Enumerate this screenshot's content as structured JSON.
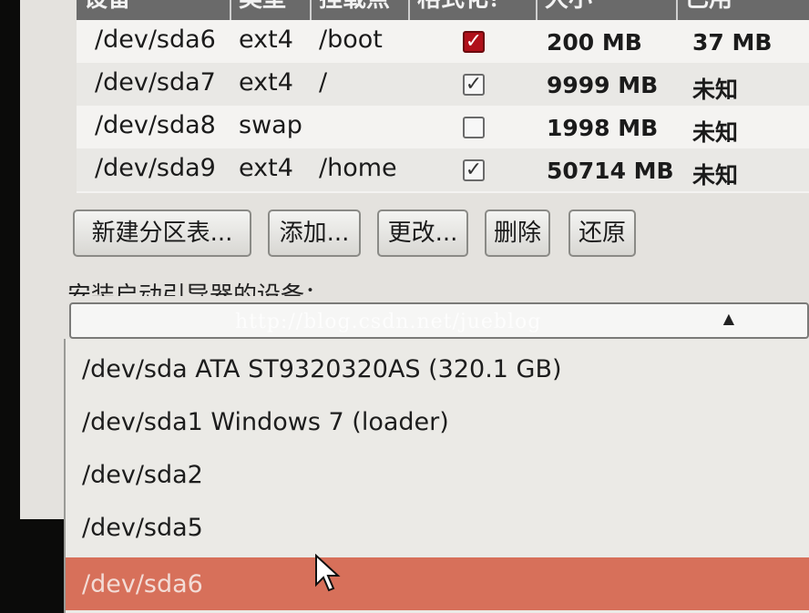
{
  "table": {
    "headers": [
      "设备",
      "类型",
      "挂载点",
      "格式化？",
      "大小",
      "已用"
    ],
    "rows": [
      {
        "device": "/dev/sda6",
        "type": "ext4",
        "mount": "/boot",
        "format": true,
        "format_style": "red",
        "size": "200 MB",
        "used": "37 MB"
      },
      {
        "device": "/dev/sda7",
        "type": "ext4",
        "mount": "/",
        "format": true,
        "format_style": "normal",
        "size": "9999 MB",
        "used": "未知"
      },
      {
        "device": "/dev/sda8",
        "type": "swap",
        "mount": "",
        "format": false,
        "format_style": "normal",
        "size": "1998 MB",
        "used": "未知"
      },
      {
        "device": "/dev/sda9",
        "type": "ext4",
        "mount": "/home",
        "format": true,
        "format_style": "normal",
        "size": "50714 MB",
        "used": "未知"
      }
    ]
  },
  "buttons": {
    "new_table": "新建分区表...",
    "add": "添加...",
    "change": "更改...",
    "delete": "删除",
    "revert": "还原"
  },
  "bootloader": {
    "label": "安装启动引导器的设备：",
    "watermark": "http://blog.csdn.net/jueblog",
    "options": [
      "/dev/sda   ATA ST9320320AS (320.1 GB)",
      "/dev/sda1  Windows 7 (loader)",
      "/dev/sda2",
      "/dev/sda5",
      "/dev/sda6"
    ],
    "selected_index": 4
  },
  "colors": {
    "selection": "#d7705a",
    "checkbox_red": "#b0101a"
  }
}
